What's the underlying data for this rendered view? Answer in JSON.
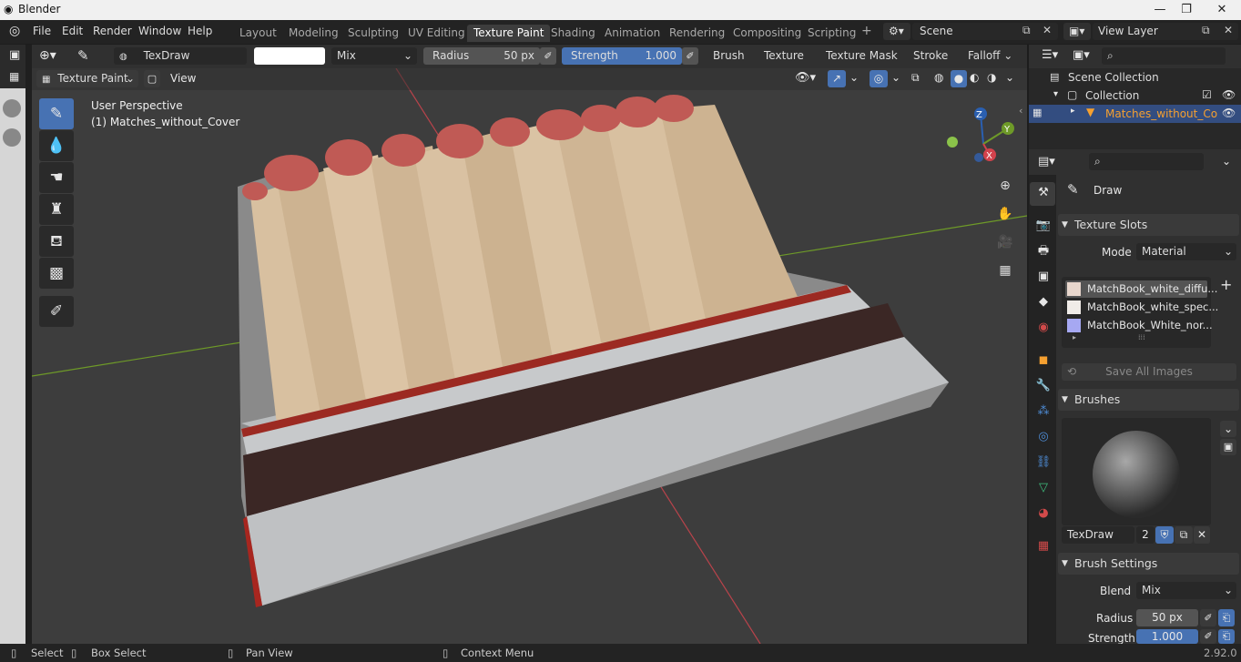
{
  "window": {
    "title": "Blender",
    "minimize": "—",
    "maximize": "❐",
    "close": "✕"
  },
  "menu": [
    "File",
    "Edit",
    "Render",
    "Window",
    "Help"
  ],
  "tabs": [
    "Layout",
    "Modeling",
    "Sculpting",
    "UV Editing",
    "Texture Paint",
    "Shading",
    "Animation",
    "Rendering",
    "Compositing",
    "Scripting"
  ],
  "scene": {
    "label": "Scene"
  },
  "view_layer": {
    "label": "View Layer"
  },
  "tool_header": {
    "brush_name": "TexDraw",
    "blend": "Mix",
    "radius_label": "Radius",
    "radius_value": "50 px",
    "strength_label": "Strength",
    "strength_value": "1.000",
    "dropdowns": [
      "Brush",
      "Texture",
      "Texture Mask",
      "Stroke",
      "Falloff"
    ]
  },
  "mode_header": {
    "mode": "Texture Paint",
    "view": "View"
  },
  "viewport": {
    "line1": "User Perspective",
    "line2": "(1) Matches_without_Cover",
    "gizmo": {
      "z": "Z",
      "y": "Y",
      "x": "X"
    }
  },
  "outliner": {
    "scene_collection": "Scene Collection",
    "collection": "Collection",
    "object": "Matches_without_Co"
  },
  "properties": {
    "tool_name": "Draw",
    "texture_slots": {
      "header": "Texture Slots",
      "mode_label": "Mode",
      "mode_value": "Material",
      "slots": [
        "MatchBook_white_diffu...",
        "MatchBook_white_spec...",
        "MatchBook_White_nor..."
      ],
      "save_all": "Save All Images"
    },
    "brushes": {
      "header": "Brushes",
      "brush_name": "TexDraw",
      "users": "2"
    },
    "brush_settings": {
      "header": "Brush Settings",
      "blend_label": "Blend",
      "blend_value": "Mix",
      "radius_label": "Radius",
      "radius_value": "50 px",
      "strength_label": "Strength",
      "strength_value": "1.000"
    }
  },
  "statusbar": {
    "select": "Select",
    "box_select": "Box Select",
    "pan_view": "Pan View",
    "context_menu": "Context Menu",
    "version": "2.92.0"
  },
  "colors": {
    "accent": "#4772b3",
    "viewport": "#3d3d3d",
    "axis_x": "#d2424c",
    "axis_y": "#6e9a28",
    "match_head": "#c05a55"
  }
}
